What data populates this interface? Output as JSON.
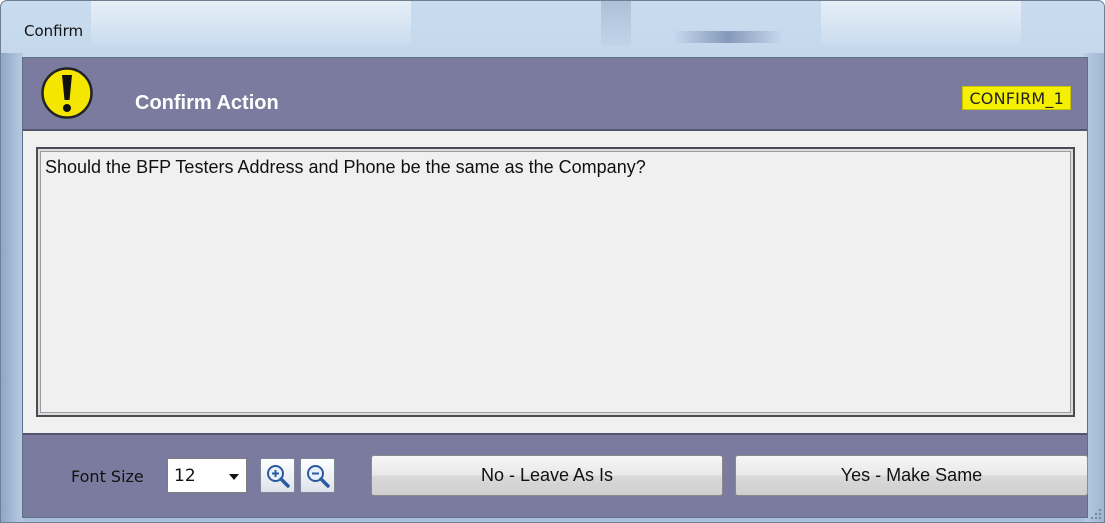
{
  "window": {
    "title": "Confirm"
  },
  "header": {
    "title": "Confirm Action",
    "code": "CONFIRM_1",
    "icon": "exclamation-warning-icon"
  },
  "message": {
    "text": "Should the BFP Testers Address and Phone be the same as the Company?"
  },
  "footer": {
    "font_size_label": "Font Size",
    "font_size_value": "12",
    "zoom_in_icon": "zoom-in-icon",
    "zoom_out_icon": "zoom-out-icon",
    "no_button": "No - Leave As Is",
    "yes_button": "Yes - Make Same"
  },
  "colors": {
    "panel": "#7b7b9f",
    "badge": "#f5f000",
    "warning": "#f5e600"
  }
}
